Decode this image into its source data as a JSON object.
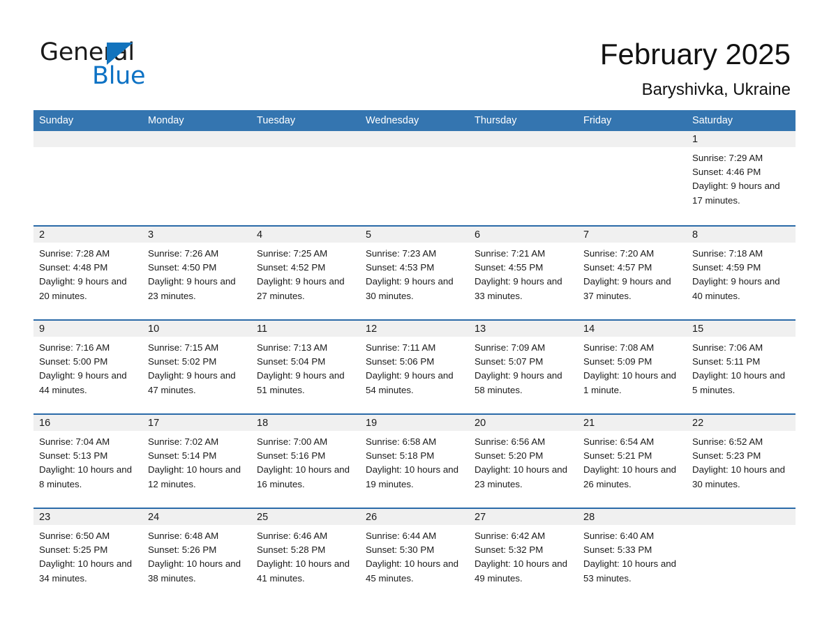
{
  "brand": {
    "word_general": "General",
    "word_blue": "Blue",
    "triangle_color": "#1273bd",
    "blue_color": "#0d72c4"
  },
  "header": {
    "month_title": "February 2025",
    "location": "Baryshivka, Ukraine"
  },
  "theme": {
    "header_bar": "#3475b0",
    "row_divider": "#2a6aa8",
    "day_band": "#f0f0f0",
    "text": "#1a1a1a",
    "page_bg": "#ffffff"
  },
  "weekdays": [
    "Sunday",
    "Monday",
    "Tuesday",
    "Wednesday",
    "Thursday",
    "Friday",
    "Saturday"
  ],
  "weeks": [
    [
      {
        "empty": true
      },
      {
        "empty": true
      },
      {
        "empty": true
      },
      {
        "empty": true
      },
      {
        "empty": true
      },
      {
        "empty": true
      },
      {
        "day": "1",
        "sunrise": "Sunrise: 7:29 AM",
        "sunset": "Sunset: 4:46 PM",
        "daylight": "Daylight: 9 hours and 17 minutes."
      }
    ],
    [
      {
        "day": "2",
        "sunrise": "Sunrise: 7:28 AM",
        "sunset": "Sunset: 4:48 PM",
        "daylight": "Daylight: 9 hours and 20 minutes."
      },
      {
        "day": "3",
        "sunrise": "Sunrise: 7:26 AM",
        "sunset": "Sunset: 4:50 PM",
        "daylight": "Daylight: 9 hours and 23 minutes."
      },
      {
        "day": "4",
        "sunrise": "Sunrise: 7:25 AM",
        "sunset": "Sunset: 4:52 PM",
        "daylight": "Daylight: 9 hours and 27 minutes."
      },
      {
        "day": "5",
        "sunrise": "Sunrise: 7:23 AM",
        "sunset": "Sunset: 4:53 PM",
        "daylight": "Daylight: 9 hours and 30 minutes."
      },
      {
        "day": "6",
        "sunrise": "Sunrise: 7:21 AM",
        "sunset": "Sunset: 4:55 PM",
        "daylight": "Daylight: 9 hours and 33 minutes."
      },
      {
        "day": "7",
        "sunrise": "Sunrise: 7:20 AM",
        "sunset": "Sunset: 4:57 PM",
        "daylight": "Daylight: 9 hours and 37 minutes."
      },
      {
        "day": "8",
        "sunrise": "Sunrise: 7:18 AM",
        "sunset": "Sunset: 4:59 PM",
        "daylight": "Daylight: 9 hours and 40 minutes."
      }
    ],
    [
      {
        "day": "9",
        "sunrise": "Sunrise: 7:16 AM",
        "sunset": "Sunset: 5:00 PM",
        "daylight": "Daylight: 9 hours and 44 minutes."
      },
      {
        "day": "10",
        "sunrise": "Sunrise: 7:15 AM",
        "sunset": "Sunset: 5:02 PM",
        "daylight": "Daylight: 9 hours and 47 minutes."
      },
      {
        "day": "11",
        "sunrise": "Sunrise: 7:13 AM",
        "sunset": "Sunset: 5:04 PM",
        "daylight": "Daylight: 9 hours and 51 minutes."
      },
      {
        "day": "12",
        "sunrise": "Sunrise: 7:11 AM",
        "sunset": "Sunset: 5:06 PM",
        "daylight": "Daylight: 9 hours and 54 minutes."
      },
      {
        "day": "13",
        "sunrise": "Sunrise: 7:09 AM",
        "sunset": "Sunset: 5:07 PM",
        "daylight": "Daylight: 9 hours and 58 minutes."
      },
      {
        "day": "14",
        "sunrise": "Sunrise: 7:08 AM",
        "sunset": "Sunset: 5:09 PM",
        "daylight": "Daylight: 10 hours and 1 minute."
      },
      {
        "day": "15",
        "sunrise": "Sunrise: 7:06 AM",
        "sunset": "Sunset: 5:11 PM",
        "daylight": "Daylight: 10 hours and 5 minutes."
      }
    ],
    [
      {
        "day": "16",
        "sunrise": "Sunrise: 7:04 AM",
        "sunset": "Sunset: 5:13 PM",
        "daylight": "Daylight: 10 hours and 8 minutes."
      },
      {
        "day": "17",
        "sunrise": "Sunrise: 7:02 AM",
        "sunset": "Sunset: 5:14 PM",
        "daylight": "Daylight: 10 hours and 12 minutes."
      },
      {
        "day": "18",
        "sunrise": "Sunrise: 7:00 AM",
        "sunset": "Sunset: 5:16 PM",
        "daylight": "Daylight: 10 hours and 16 minutes."
      },
      {
        "day": "19",
        "sunrise": "Sunrise: 6:58 AM",
        "sunset": "Sunset: 5:18 PM",
        "daylight": "Daylight: 10 hours and 19 minutes."
      },
      {
        "day": "20",
        "sunrise": "Sunrise: 6:56 AM",
        "sunset": "Sunset: 5:20 PM",
        "daylight": "Daylight: 10 hours and 23 minutes."
      },
      {
        "day": "21",
        "sunrise": "Sunrise: 6:54 AM",
        "sunset": "Sunset: 5:21 PM",
        "daylight": "Daylight: 10 hours and 26 minutes."
      },
      {
        "day": "22",
        "sunrise": "Sunrise: 6:52 AM",
        "sunset": "Sunset: 5:23 PM",
        "daylight": "Daylight: 10 hours and 30 minutes."
      }
    ],
    [
      {
        "day": "23",
        "sunrise": "Sunrise: 6:50 AM",
        "sunset": "Sunset: 5:25 PM",
        "daylight": "Daylight: 10 hours and 34 minutes."
      },
      {
        "day": "24",
        "sunrise": "Sunrise: 6:48 AM",
        "sunset": "Sunset: 5:26 PM",
        "daylight": "Daylight: 10 hours and 38 minutes."
      },
      {
        "day": "25",
        "sunrise": "Sunrise: 6:46 AM",
        "sunset": "Sunset: 5:28 PM",
        "daylight": "Daylight: 10 hours and 41 minutes."
      },
      {
        "day": "26",
        "sunrise": "Sunrise: 6:44 AM",
        "sunset": "Sunset: 5:30 PM",
        "daylight": "Daylight: 10 hours and 45 minutes."
      },
      {
        "day": "27",
        "sunrise": "Sunrise: 6:42 AM",
        "sunset": "Sunset: 5:32 PM",
        "daylight": "Daylight: 10 hours and 49 minutes."
      },
      {
        "day": "28",
        "sunrise": "Sunrise: 6:40 AM",
        "sunset": "Sunset: 5:33 PM",
        "daylight": "Daylight: 10 hours and 53 minutes."
      },
      {
        "empty": true
      }
    ]
  ]
}
